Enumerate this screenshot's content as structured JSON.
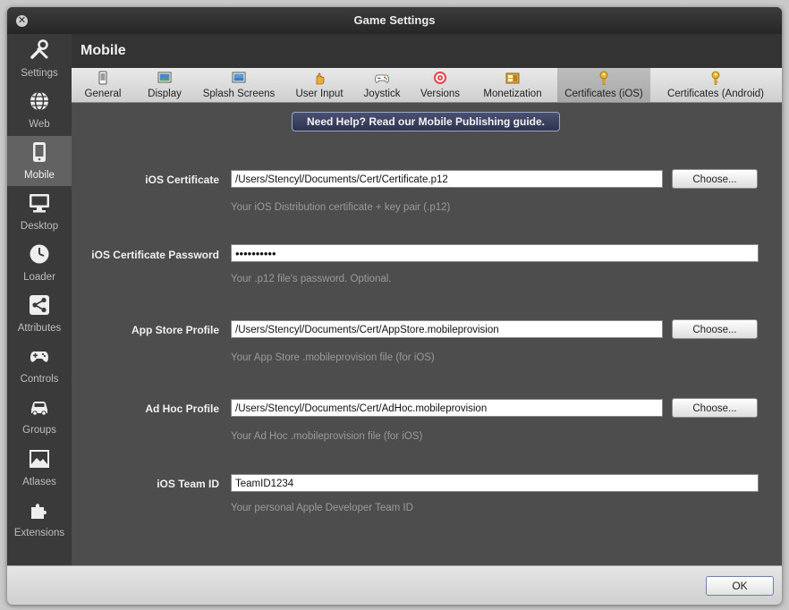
{
  "window": {
    "title": "Game Settings"
  },
  "sidebar": {
    "items": [
      {
        "label": "Settings",
        "icon": "wrench-icon"
      },
      {
        "label": "Web",
        "icon": "globe-icon"
      },
      {
        "label": "Mobile",
        "icon": "phone-icon",
        "active": true
      },
      {
        "label": "Desktop",
        "icon": "monitor-icon"
      },
      {
        "label": "Loader",
        "icon": "clock-icon"
      },
      {
        "label": "Attributes",
        "icon": "share-icon"
      },
      {
        "label": "Controls",
        "icon": "gamepad-icon"
      },
      {
        "label": "Groups",
        "icon": "car-icon"
      },
      {
        "label": "Atlases",
        "icon": "image-icon"
      },
      {
        "label": "Extensions",
        "icon": "puzzle-icon"
      }
    ]
  },
  "section": {
    "title": "Mobile"
  },
  "tabs": [
    {
      "label": "General",
      "icon": "phone-small-icon"
    },
    {
      "label": "Display",
      "icon": "display-icon"
    },
    {
      "label": "Splash Screens",
      "icon": "splash-icon"
    },
    {
      "label": "User Input",
      "icon": "hand-icon"
    },
    {
      "label": "Joystick",
      "icon": "joystick-icon"
    },
    {
      "label": "Versions",
      "icon": "target-icon"
    },
    {
      "label": "Monetization",
      "icon": "monetization-icon"
    },
    {
      "label": "Certificates (iOS)",
      "icon": "key-icon",
      "active": true
    },
    {
      "label": "Certificates (Android)",
      "icon": "key-icon"
    }
  ],
  "help_button": "Need Help? Read our Mobile Publishing guide.",
  "form": {
    "ios_certificate": {
      "label": "iOS Certificate",
      "value": "/Users/Stencyl/Documents/Cert/Certificate.p12",
      "hint": "Your iOS Distribution certificate + key pair (.p12)",
      "button": "Choose..."
    },
    "ios_password": {
      "label": "iOS Certificate Password",
      "value": "••••••••••",
      "hint": "Your .p12 file's password. Optional."
    },
    "app_store_profile": {
      "label": "App Store Profile",
      "value": "/Users/Stencyl/Documents/Cert/AppStore.mobileprovision",
      "hint": "Your App Store .mobileprovision file (for iOS)",
      "button": "Choose..."
    },
    "ad_hoc_profile": {
      "label": "Ad Hoc Profile",
      "value": "/Users/Stencyl/Documents/Cert/AdHoc.mobileprovision",
      "hint": "Your Ad Hoc .mobileprovision file (for iOS)",
      "button": "Choose..."
    },
    "team_id": {
      "label": "iOS Team ID",
      "value": "TeamID1234",
      "hint": "Your personal Apple Developer Team ID"
    }
  },
  "footer": {
    "ok": "OK"
  }
}
